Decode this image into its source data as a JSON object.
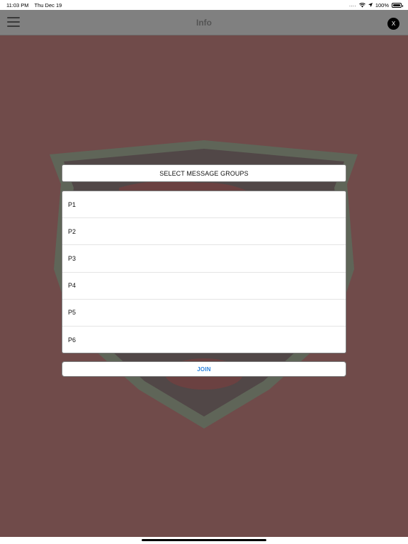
{
  "status_bar": {
    "time": "11:03 PM",
    "date": "Thu Dec 19",
    "signal": "....",
    "battery": "100%"
  },
  "nav_bar": {
    "title": "Info",
    "close_label": "X"
  },
  "dialog": {
    "title": "SELECT MESSAGE GROUPS",
    "groups": [
      {
        "label": "P1"
      },
      {
        "label": "P2"
      },
      {
        "label": "P3"
      },
      {
        "label": "P4"
      },
      {
        "label": "P5"
      },
      {
        "label": "P6"
      }
    ],
    "join_label": "JOIN"
  },
  "colors": {
    "background": "#704b4a",
    "nav_bar": "#808080",
    "join_text": "#2f86e0"
  },
  "icons": {
    "menu": "hamburger-icon",
    "close": "close-icon",
    "wifi": "wifi-icon",
    "location": "location-arrow-icon",
    "battery": "battery-icon",
    "background": "shield-logo"
  }
}
